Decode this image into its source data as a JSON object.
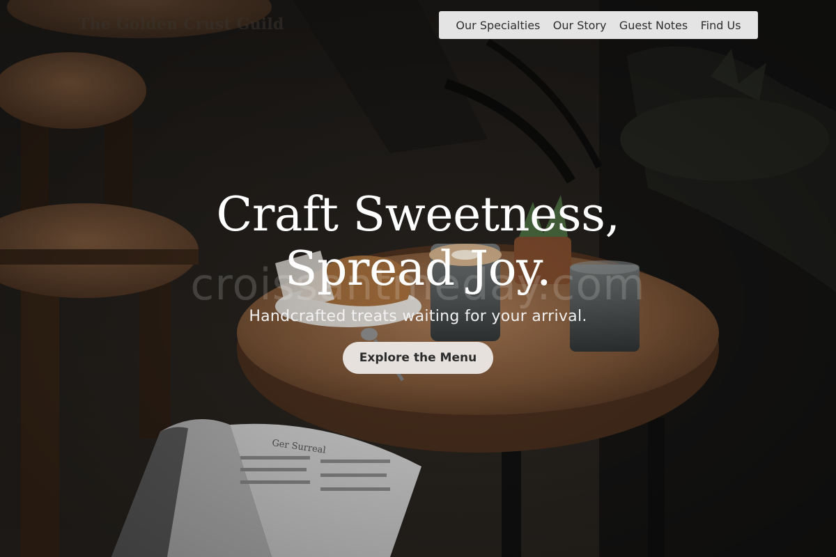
{
  "brand": {
    "name": "The Golden Crust Guild"
  },
  "nav": {
    "items": [
      {
        "label": "Our Specialties"
      },
      {
        "label": "Our Story"
      },
      {
        "label": "Guest Notes"
      },
      {
        "label": "Find Us"
      }
    ]
  },
  "hero": {
    "headline_line1": "Craft Sweetness,",
    "headline_line2": "Spread Joy.",
    "subtitle": "Handcrafted treats waiting for your arrival.",
    "cta_label": "Explore the Menu"
  },
  "background": {
    "watermark": "croissantmeday.com",
    "book_heading": "Ger Surreal"
  },
  "colors": {
    "nav_bg": "#e4e4e4",
    "cta_bg": "#e7e1de",
    "headline": "#ffffff",
    "wood": "#8a6040"
  }
}
